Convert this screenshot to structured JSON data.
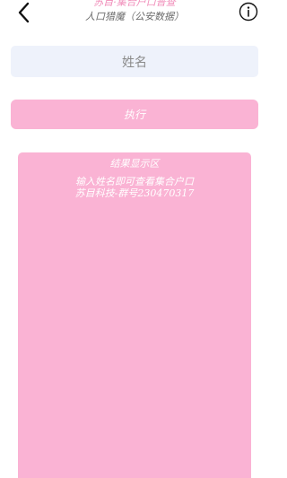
{
  "header": {
    "title_line1": "苏目·集合户口普查",
    "title_line2": "人口猎魔（公安数据）",
    "back_icon": "chevron-left-icon",
    "info_icon": "info-circle-icon"
  },
  "form": {
    "name_placeholder": "姓名",
    "name_value": "",
    "execute_label": "执行"
  },
  "result": {
    "title": "结果显示区",
    "lines": [
      "输入姓名即可查看集合户口",
      "苏目科技-群号230470317"
    ]
  },
  "colors": {
    "accent_pink": "#fab3d4",
    "title_pink": "#f08bb8",
    "input_bg": "#eef2fb"
  }
}
